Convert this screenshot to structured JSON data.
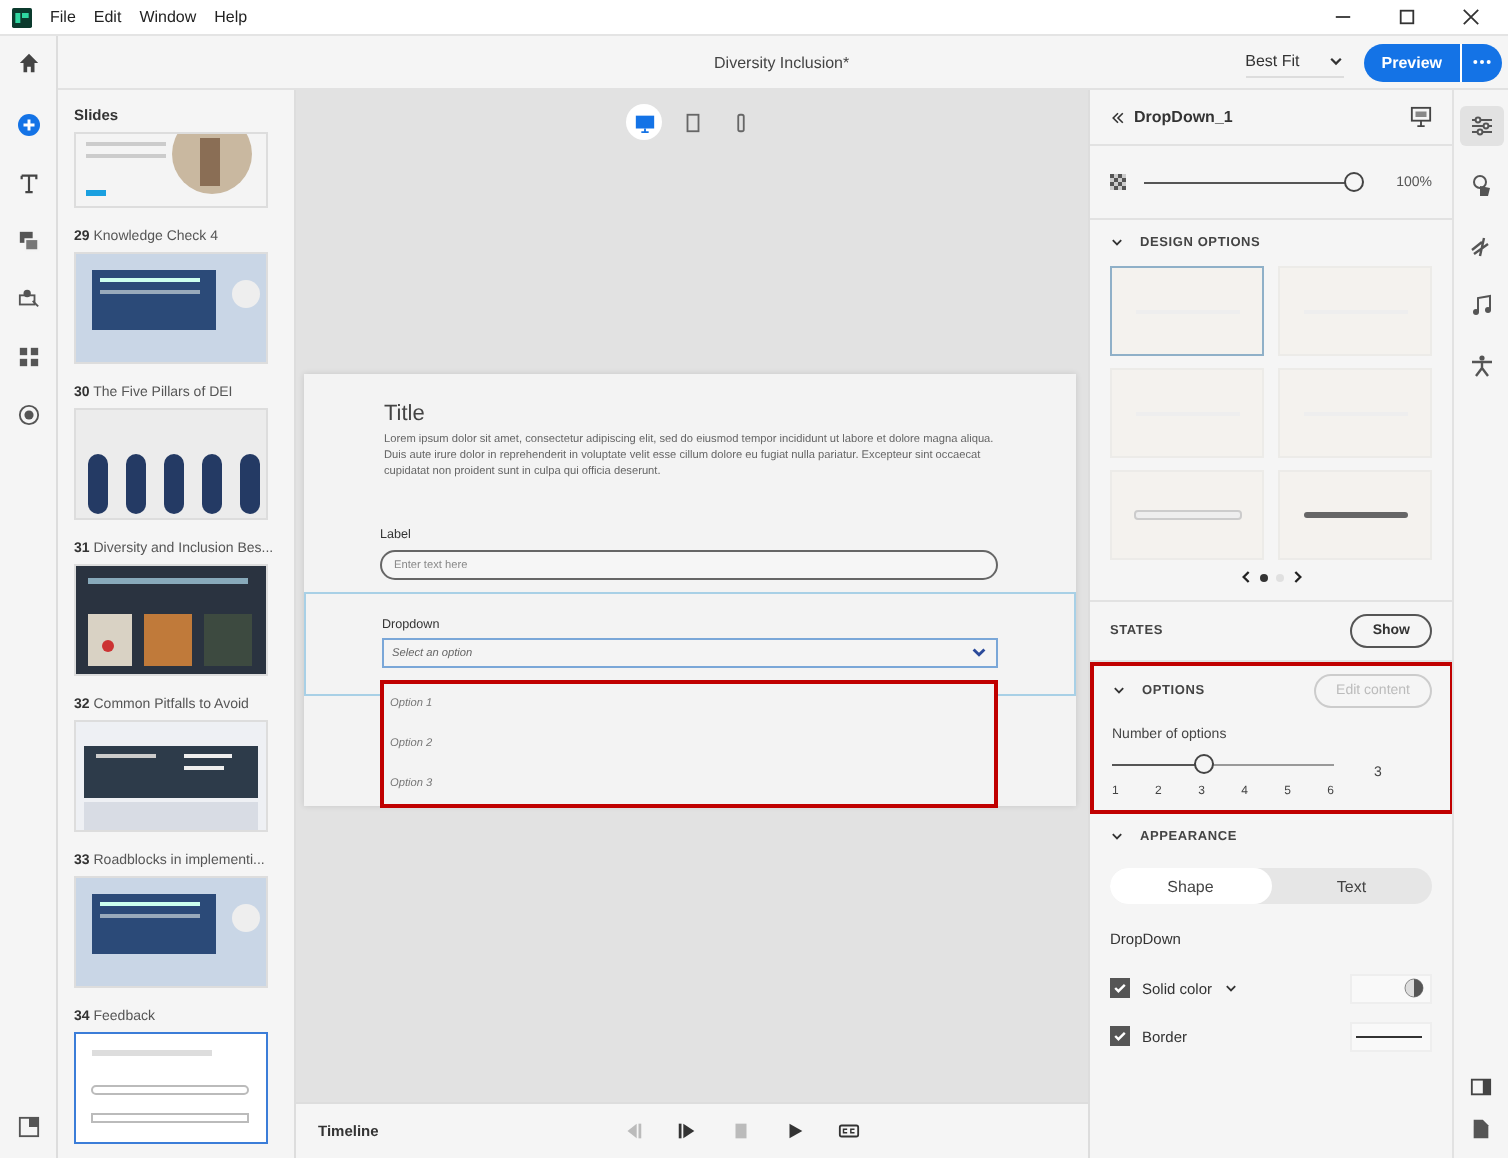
{
  "menu": [
    "File",
    "Edit",
    "Window",
    "Help"
  ],
  "document_title": "Diversity Inclusion*",
  "zoom": {
    "value": "Best Fit"
  },
  "preview_button": "Preview",
  "slides_panel": {
    "title": "Slides",
    "slides": [
      {
        "number": "29",
        "title": "Knowledge Check 4",
        "selected": false
      },
      {
        "number": "30",
        "title": "The Five Pillars of DEI",
        "selected": false
      },
      {
        "number": "31",
        "title": "Diversity and Inclusion Bes...",
        "selected": false
      },
      {
        "number": "32",
        "title": "Common Pitfalls to Avoid",
        "selected": false
      },
      {
        "number": "33",
        "title": "Roadblocks in implementi...",
        "selected": false
      },
      {
        "number": "34",
        "title": "Feedback",
        "selected": true
      }
    ]
  },
  "devices": [
    {
      "kind": "desktop",
      "selected": true
    },
    {
      "kind": "tablet",
      "selected": false
    },
    {
      "kind": "phone",
      "selected": false
    }
  ],
  "slide": {
    "title": "Title",
    "body": "Lorem ipsum dolor sit amet, consectetur adipiscing elit, sed do eiusmod tempor incididunt ut labore et dolore magna aliqua. Duis aute irure dolor in reprehenderit in voluptate velit esse cillum dolore eu fugiat nulla pariatur. Excepteur sint occaecat cupidatat non proident sunt in culpa qui officia deserunt.",
    "text_label": "Label",
    "text_placeholder": "Enter text here",
    "dropdown_label": "Dropdown",
    "dropdown_placeholder": "Select an option",
    "options": [
      "Option 1",
      "Option 2",
      "Option 3"
    ]
  },
  "timeline": {
    "title": "Timeline"
  },
  "properties": {
    "name": "DropDown_1",
    "opacity": {
      "level": 1,
      "reading": "100%"
    },
    "design_options": {
      "title": "DESIGN OPTIONS",
      "tiles": [
        {
          "selected": true
        },
        {
          "selected": false
        },
        {
          "selected": false
        },
        {
          "selected": false
        },
        {
          "selected": false
        },
        {
          "selected": false
        }
      ]
    },
    "states": {
      "title": "STATES",
      "button": "Show"
    },
    "options": {
      "title": "OPTIONS",
      "button": "Edit content",
      "button_disabled": true,
      "count_label": "Number of options",
      "level": 0.4,
      "ticks": [
        "1",
        "2",
        "3",
        "4",
        "5",
        "6"
      ],
      "reading": "3"
    },
    "appearance": {
      "title": "APPEARANCE",
      "tabs": [
        {
          "label": "Shape",
          "selected": true
        },
        {
          "label": "Text",
          "selected": false
        }
      ],
      "group": "DropDown",
      "rows": [
        {
          "label": "Solid color",
          "checked": true,
          "kind": "fill"
        },
        {
          "label": "Border",
          "checked": true,
          "kind": "border"
        }
      ]
    }
  },
  "right_rail": [
    {
      "kind": "properties",
      "selected": true
    },
    {
      "kind": "interaction",
      "selected": false
    },
    {
      "kind": "animation",
      "selected": false
    },
    {
      "kind": "audio",
      "selected": false
    },
    {
      "kind": "accessibility",
      "selected": false
    }
  ]
}
